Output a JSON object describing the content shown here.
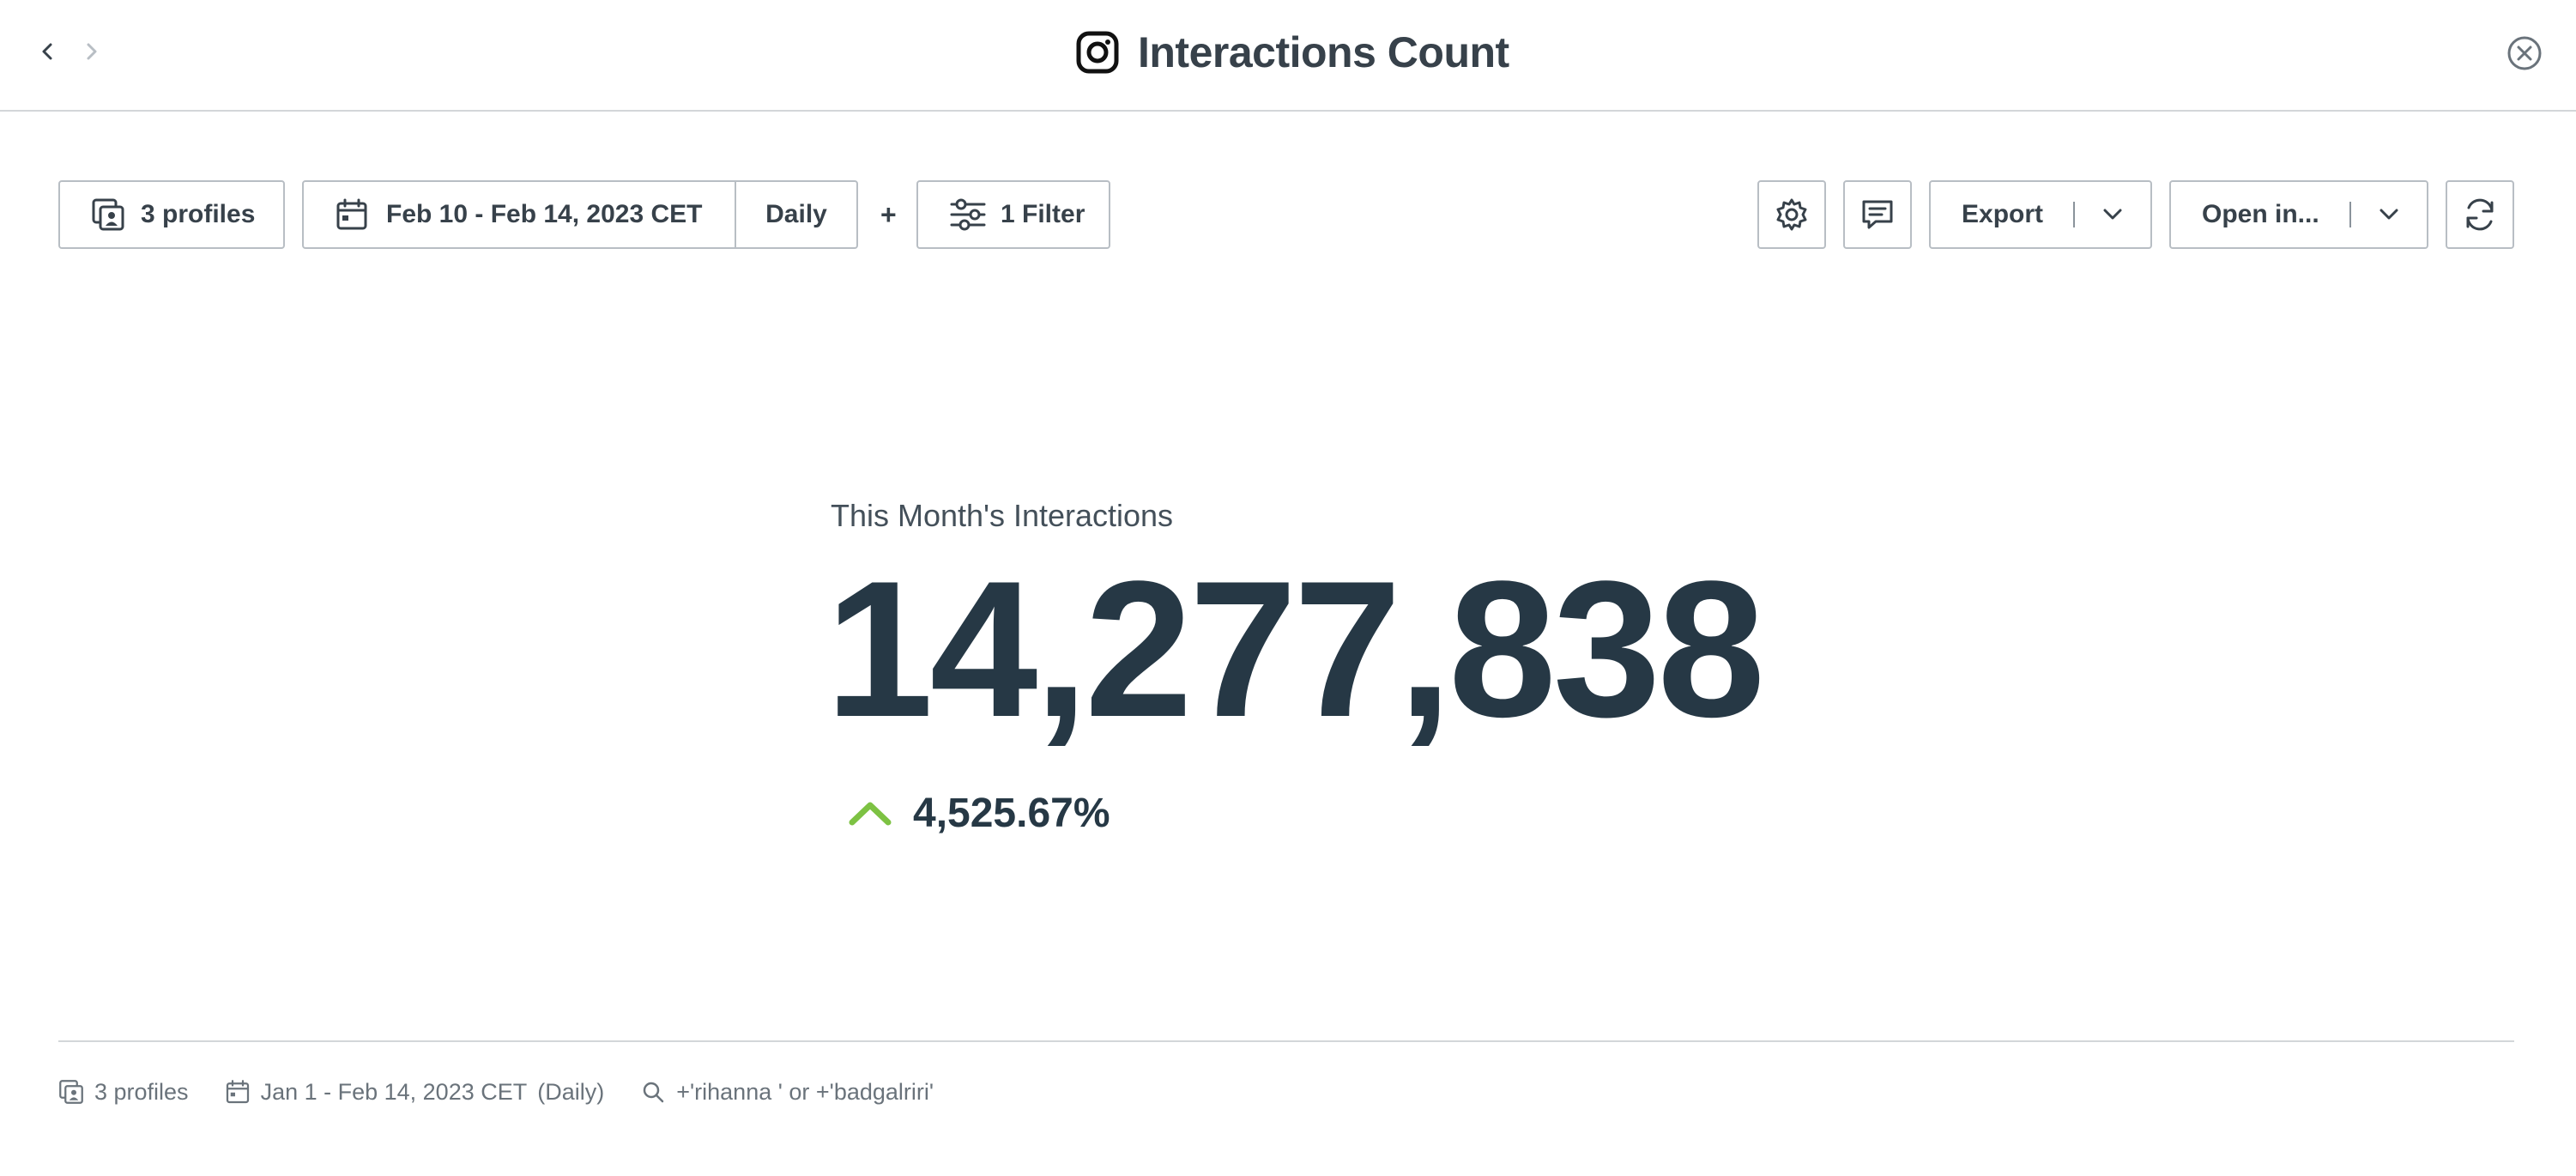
{
  "header": {
    "title": "Interactions Count",
    "title_icon": "instagram-icon"
  },
  "toolbar": {
    "profiles_label": "3 profiles",
    "date_range": "Feb 10 - Feb 14, 2023 CET",
    "granularity": "Daily",
    "plus": "+",
    "filter_label": "1 Filter",
    "export_label": "Export",
    "open_in_label": "Open in..."
  },
  "metric": {
    "label": "This Month's Interactions",
    "value": "14,277,838",
    "change": "4,525.67%",
    "change_direction": "up",
    "change_color": "#7dc243"
  },
  "footer": {
    "profiles": "3 profiles",
    "date_range": "Jan 1 - Feb 14, 2023 CET",
    "granularity": "(Daily)",
    "query": "+'rihanna ' or +'badgalriri'"
  },
  "colors": {
    "text_dark": "#263845",
    "accent_up": "#7dc243",
    "border": "#b8bec4"
  }
}
